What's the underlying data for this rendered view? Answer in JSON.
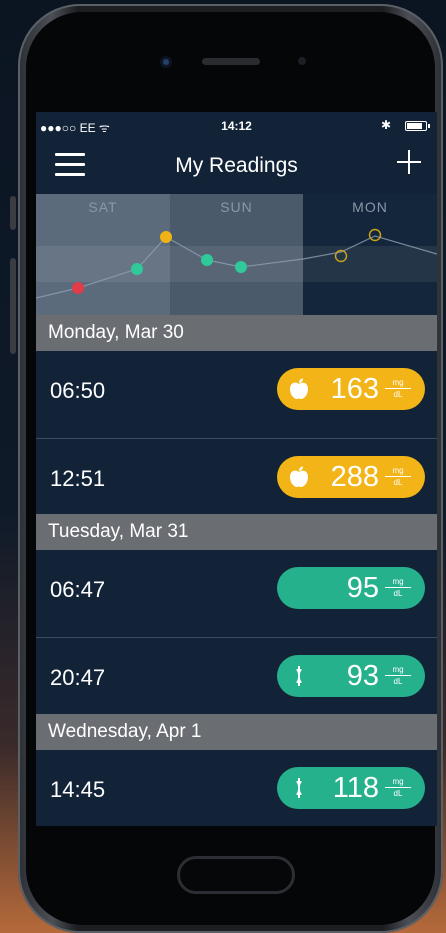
{
  "status_bar": {
    "carrier": "●●●○○ EE ᯤ",
    "time": "14:12",
    "bluetooth": "✱",
    "battery_level": 0.85
  },
  "nav": {
    "title": "My Readings",
    "menu_icon": "hamburger-menu-icon",
    "add_icon": "plus-icon"
  },
  "chart": {
    "days": [
      "SAT",
      "SUN",
      "MON"
    ],
    "colors": {
      "low": "#e23b4a",
      "normal": "#2fc99a",
      "high": "#f0b315",
      "future": "#c9a21a"
    }
  },
  "sections": [
    {
      "date": "Monday, Mar 30",
      "readings": [
        {
          "time": "06:50",
          "value": "163",
          "unit_top": "mg",
          "unit_bottom": "dL",
          "status": "high",
          "meal": "before-meal",
          "icon": "apple-icon"
        },
        {
          "time": "12:51",
          "value": "288",
          "unit_top": "mg",
          "unit_bottom": "dL",
          "status": "high",
          "meal": "before-meal",
          "icon": "apple-icon"
        }
      ]
    },
    {
      "date": "Tuesday, Mar 31",
      "readings": [
        {
          "time": "06:47",
          "value": "95",
          "unit_top": "mg",
          "unit_bottom": "dL",
          "status": "normal",
          "meal": "none",
          "icon": ""
        },
        {
          "time": "20:47",
          "value": "93",
          "unit_top": "mg",
          "unit_bottom": "dL",
          "status": "normal",
          "meal": "after-meal",
          "icon": "apple-core-icon"
        }
      ]
    },
    {
      "date": "Wednesday, Apr 1",
      "readings": [
        {
          "time": "14:45",
          "value": "118",
          "unit_top": "mg",
          "unit_bottom": "dL",
          "status": "normal",
          "meal": "after-meal",
          "icon": "apple-core-icon"
        }
      ]
    }
  ],
  "colors": {
    "high": "#f2b416",
    "normal": "#26b18d",
    "section_bg": "#6a6d72",
    "screen_bg": "#122338"
  }
}
